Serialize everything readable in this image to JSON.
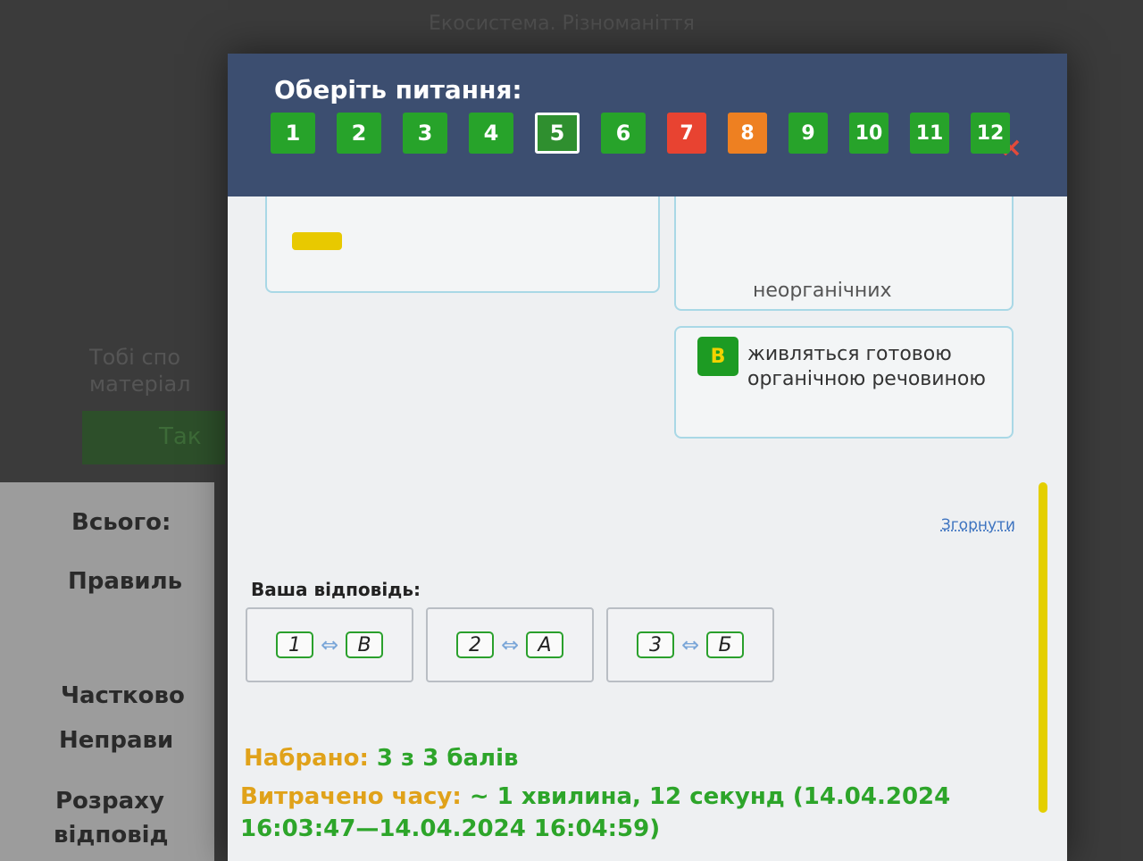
{
  "background": {
    "page_title": "Екосистема. Різноманіття",
    "hint_text": [
      "Тобі спо",
      "матеріал"
    ],
    "button_label": "Так",
    "labels": [
      "Всього:",
      "Правиль",
      "Частково",
      "Неправи",
      "Розраху",
      "відповід"
    ]
  },
  "modal": {
    "title": "Оберіть питання:",
    "close_icon": "×",
    "questions": [
      {
        "n": "1",
        "status": "correct"
      },
      {
        "n": "2",
        "status": "correct"
      },
      {
        "n": "3",
        "status": "correct"
      },
      {
        "n": "4",
        "status": "correct"
      },
      {
        "n": "5",
        "status": "current"
      },
      {
        "n": "6",
        "status": "correct"
      },
      {
        "n": "7",
        "status": "wrong"
      },
      {
        "n": "8",
        "status": "partial"
      },
      {
        "n": "9",
        "status": "correct"
      },
      {
        "n": "10",
        "status": "correct"
      },
      {
        "n": "11",
        "status": "correct"
      },
      {
        "n": "12",
        "status": "correct"
      }
    ],
    "colors": {
      "correct": "#27a32a",
      "wrong": "#e84331",
      "partial": "#ee8021",
      "header": "#3c4e70"
    }
  },
  "question": {
    "partial_option_text": "неорганічних",
    "option_b": {
      "letter": "В",
      "text": "живляться готовою органічною речовиною"
    },
    "collapse_label": "Згорнути"
  },
  "answer": {
    "heading": "Ваша відповідь:",
    "pairs": [
      {
        "left": "1",
        "right": "В"
      },
      {
        "left": "2",
        "right": "А"
      },
      {
        "left": "3",
        "right": "Б"
      }
    ],
    "arrow": "⇔"
  },
  "result": {
    "score_label": "Набрано:",
    "score_value": "3 з 3 балів",
    "time_label": "Витрачено часу:",
    "time_value": "~ 1 хвилина, 12 секунд (14.04.2024 16:03:47—14.04.2024 16:04:59)"
  }
}
